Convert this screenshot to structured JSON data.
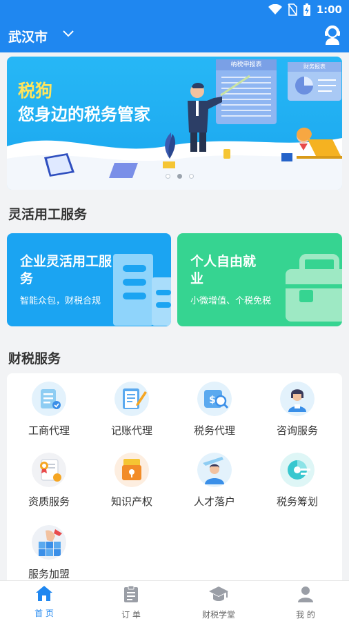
{
  "status": {
    "time": "1:00"
  },
  "header": {
    "city": "武汉市"
  },
  "banner": {
    "title1": "税狗",
    "title2": "您身边的税务管家",
    "board_title": "纳税申报表",
    "board2_title": "财务报表"
  },
  "flex_section": {
    "title": "灵活用工服务",
    "cards": [
      {
        "title": "企业灵活用工服务",
        "subtitle": "智能众包，财税合规",
        "color": "#1ba4f2"
      },
      {
        "title": "个人自由就业",
        "subtitle": "小微增值、个税免税",
        "color": "#36d491"
      }
    ]
  },
  "tax_section": {
    "title": "财税服务",
    "items": [
      {
        "label": "工商代理",
        "icon": "business-agency-icon"
      },
      {
        "label": "记账代理",
        "icon": "bookkeeping-icon"
      },
      {
        "label": "税务代理",
        "icon": "tax-agency-icon"
      },
      {
        "label": "咨询服务",
        "icon": "consulting-icon"
      },
      {
        "label": "资质服务",
        "icon": "qualification-icon"
      },
      {
        "label": "知识产权",
        "icon": "ip-icon"
      },
      {
        "label": "人才落户",
        "icon": "talent-icon"
      },
      {
        "label": "税务筹划",
        "icon": "tax-planning-icon"
      },
      {
        "label": "服务加盟",
        "icon": "franchise-icon"
      }
    ]
  },
  "tabs": [
    {
      "label": "首 页",
      "icon": "home-icon",
      "active": true
    },
    {
      "label": "订 单",
      "icon": "order-icon",
      "active": false
    },
    {
      "label": "财税学堂",
      "icon": "school-icon",
      "active": false
    },
    {
      "label": "我 的",
      "icon": "profile-icon",
      "active": false
    }
  ],
  "colors": {
    "primary": "#1f87f0",
    "card_blue": "#1ba4f2",
    "card_green": "#36d491"
  }
}
